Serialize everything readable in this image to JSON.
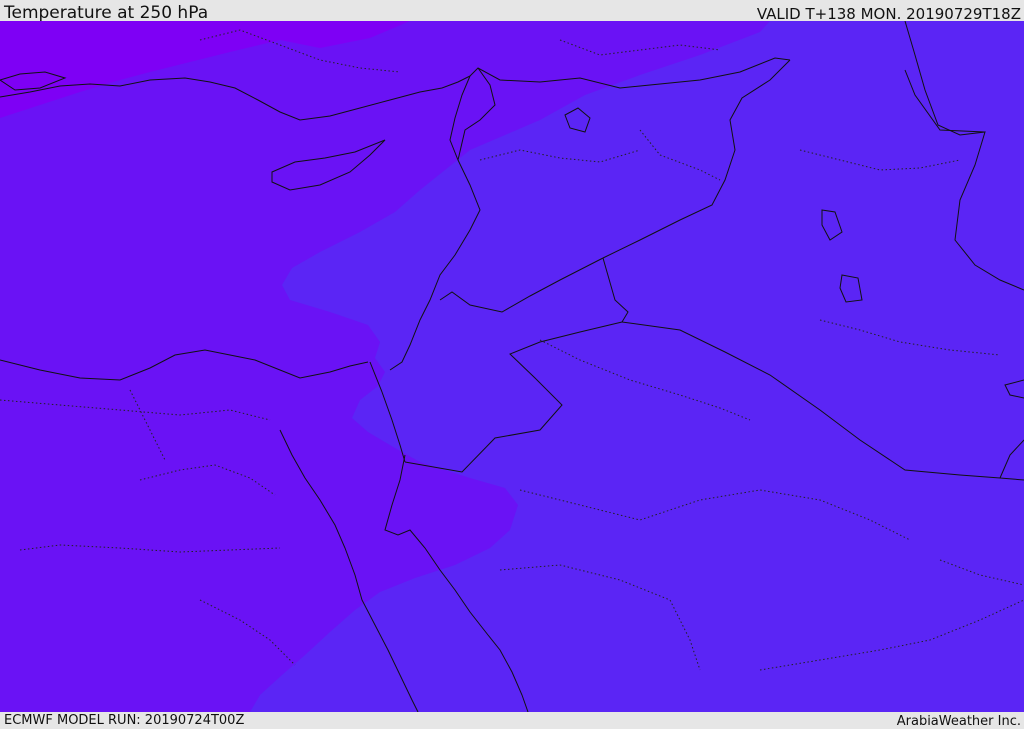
{
  "header": {
    "title": "Temperature at 250 hPa",
    "valid": "VALID T+138 MON. 20190729T18Z"
  },
  "footer": {
    "model_run": "ECMWF MODEL RUN: 20190724T00Z",
    "credit": "ArabiaWeather Inc."
  },
  "colors": {
    "band_coldest": "#7e00f5",
    "band_cold": "#6a12f5",
    "band_mild": "#5b25f5",
    "bar_background": "#e6e6e6",
    "outline": "#111111"
  }
}
